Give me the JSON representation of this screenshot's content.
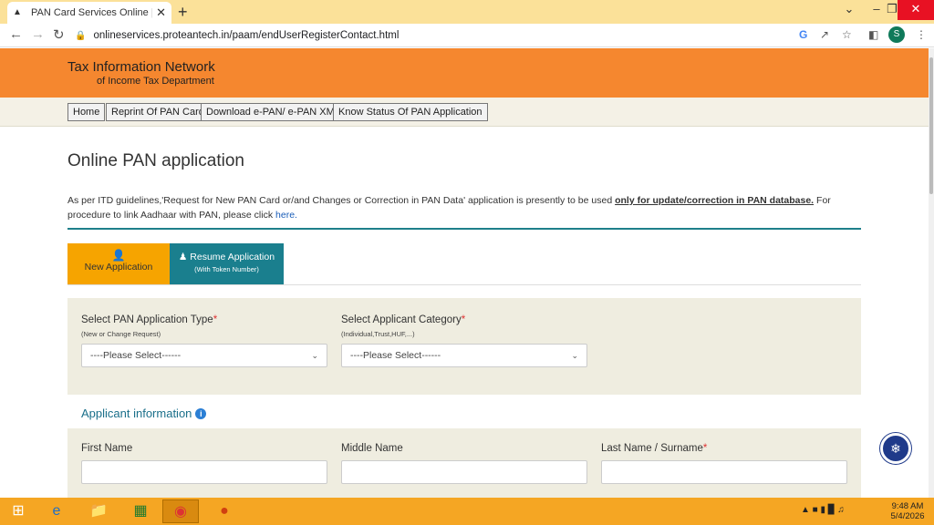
{
  "browser": {
    "tab_title": "PAN Card Services Online | Apply",
    "new_tab": "+",
    "url": "onlineservices.proteantech.in/paam/endUserRegisterContact.html",
    "profile_initial": "S"
  },
  "header": {
    "logo_line1": "Tax Information Network",
    "logo_line2": "of Income Tax Department"
  },
  "nav": {
    "items": [
      "Home",
      "Reprint Of PAN Card",
      "Download e-PAN/ e-PAN XML",
      "Know Status Of PAN Application"
    ]
  },
  "main": {
    "title": "Online PAN application",
    "notice_pre": "As per ITD guidelines,'Request for New PAN Card or/and Changes or Correction in PAN Data' application is presently to be used ",
    "notice_bold": "only for update/correction in PAN database.",
    "notice_post": " For procedure to link Aadhaar with PAN, please click ",
    "notice_link": "here.",
    "tabs": [
      {
        "label": "New Application",
        "sub": ""
      },
      {
        "label": "Resume Application",
        "sub": "(With Token Number)"
      }
    ],
    "app_type": {
      "label": "Select PAN Application Type",
      "hint": "(New or Change Request)",
      "value": "----Please Select------"
    },
    "category": {
      "label": "Select Applicant Category",
      "hint": "(Individual,Trust,HUF,...)",
      "value": "----Please Select------"
    },
    "applicant_info_title": "Applicant information",
    "first_name_label": "First Name",
    "middle_name_label": "Middle Name",
    "last_name_label": "Last Name / Surname",
    "required_mark": "*"
  },
  "taskbar": {
    "time": "9:48 AM",
    "date": "5/4/2026"
  }
}
